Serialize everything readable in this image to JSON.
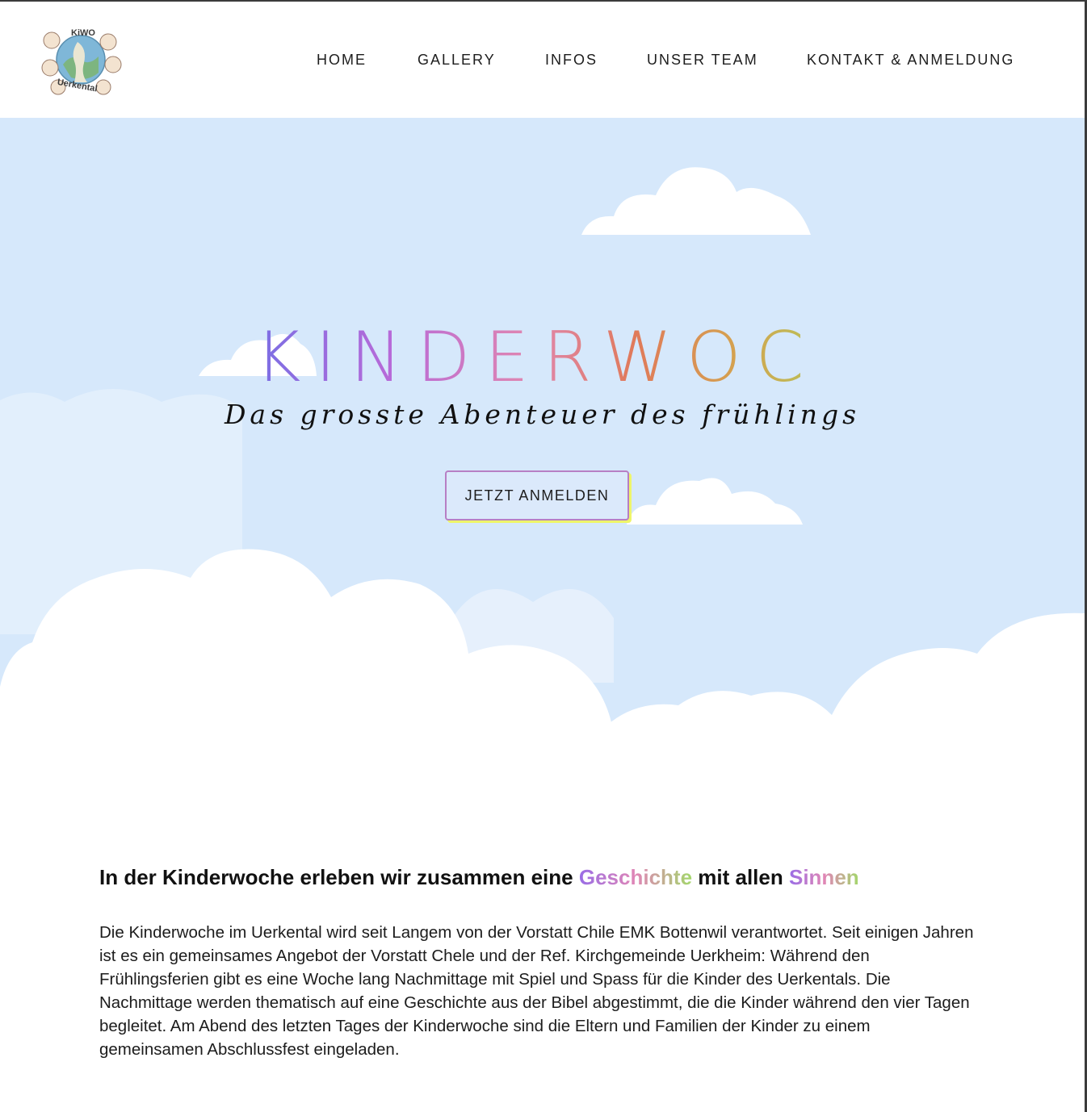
{
  "logo": {
    "top_text": "KiWO",
    "bottom_text": "Uerkental"
  },
  "nav": {
    "items": [
      {
        "label": "HOME"
      },
      {
        "label": "GALLERY"
      },
      {
        "label": "INFOS"
      },
      {
        "label": "UNSER TEAM"
      },
      {
        "label": "KONTAKT & ANMELDUNG"
      }
    ]
  },
  "hero": {
    "title": "KINDERWOCHE",
    "subtitle": "Das grosste Abenteuer des frühlings",
    "cta_label": "JETZT ANMELDEN"
  },
  "intro": {
    "headline_part1": "In der Kinderwoche erleben wir zusammen eine",
    "headline_highlight1": "Geschichte",
    "headline_part2": "mit allen",
    "headline_highlight2": "Sinnen",
    "body": "Die Kinderwoche im Uerkental wird seit Langem von der Vorstatt Chile EMK Bottenwil verantwortet. Seit einigen Jahren ist es ein gemeinsames Angebot der Vorstatt Chele und der Ref. Kirchgemeinde Uerkheim: Während den Frühlingsferien gibt es eine Woche lang Nachmittage mit Spiel und Spass für die Kinder des Uerkentals. Die Nachmittage werden thematisch auf eine Geschichte aus der Bibel abgestimmt, die die Kinder während den vier Tagen begleitet. Am Abend des letzten Tages der Kinderwoche sind die Eltern und Familien der Kinder zu einem gemeinsamen Abschlussfest eingeladen."
  },
  "colors": {
    "sky": "#d6e8fb",
    "cloud": "#ffffff",
    "button_border": "#b77fc4",
    "button_shadow": "#eef56a",
    "title_gradient": [
      "#7b6fe4",
      "#b86ad8",
      "#e087b0",
      "#e07a5a",
      "#d4a24f",
      "#b2c95a",
      "#6cc08e"
    ]
  }
}
